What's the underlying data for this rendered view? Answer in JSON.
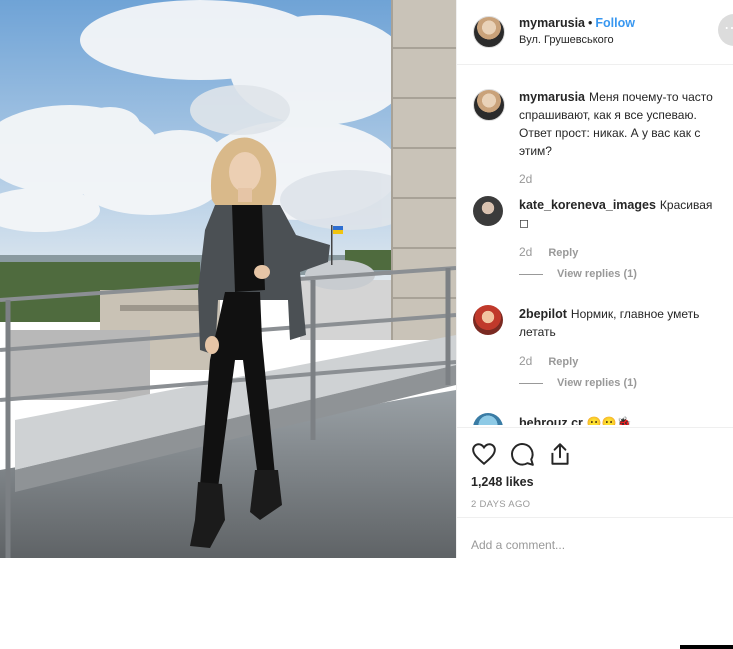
{
  "post": {
    "username": "mymarusia",
    "follow_label": "Follow",
    "separator": "•",
    "location": "Вул. Грушевського",
    "more_icon": "more-options-icon"
  },
  "comments": [
    {
      "username": "mymarusia",
      "text": "Меня почему-то часто спрашивают, как я все успеваю. Ответ прост: никак. А у вас как с этим?",
      "time": "2d"
    },
    {
      "username": "kate_koreneva_images",
      "text": "Красивая ◻",
      "time": "2d",
      "reply_label": "Reply",
      "view_replies": "View replies (1)"
    },
    {
      "username": "2bepilot",
      "text": "Нормик, главное уметь летать",
      "time": "2d",
      "reply_label": "Reply",
      "view_replies": "View replies (1)"
    },
    {
      "username": "behrouz.cr",
      "text": "😶😶🐞"
    }
  ],
  "actions": {
    "like_icon": "heart-icon",
    "comment_icon": "comment-icon",
    "share_icon": "share-icon",
    "likes": "1,248 likes",
    "posted_ago": "2 DAYS AGO"
  },
  "add_comment": {
    "placeholder": "Add a comment..."
  }
}
